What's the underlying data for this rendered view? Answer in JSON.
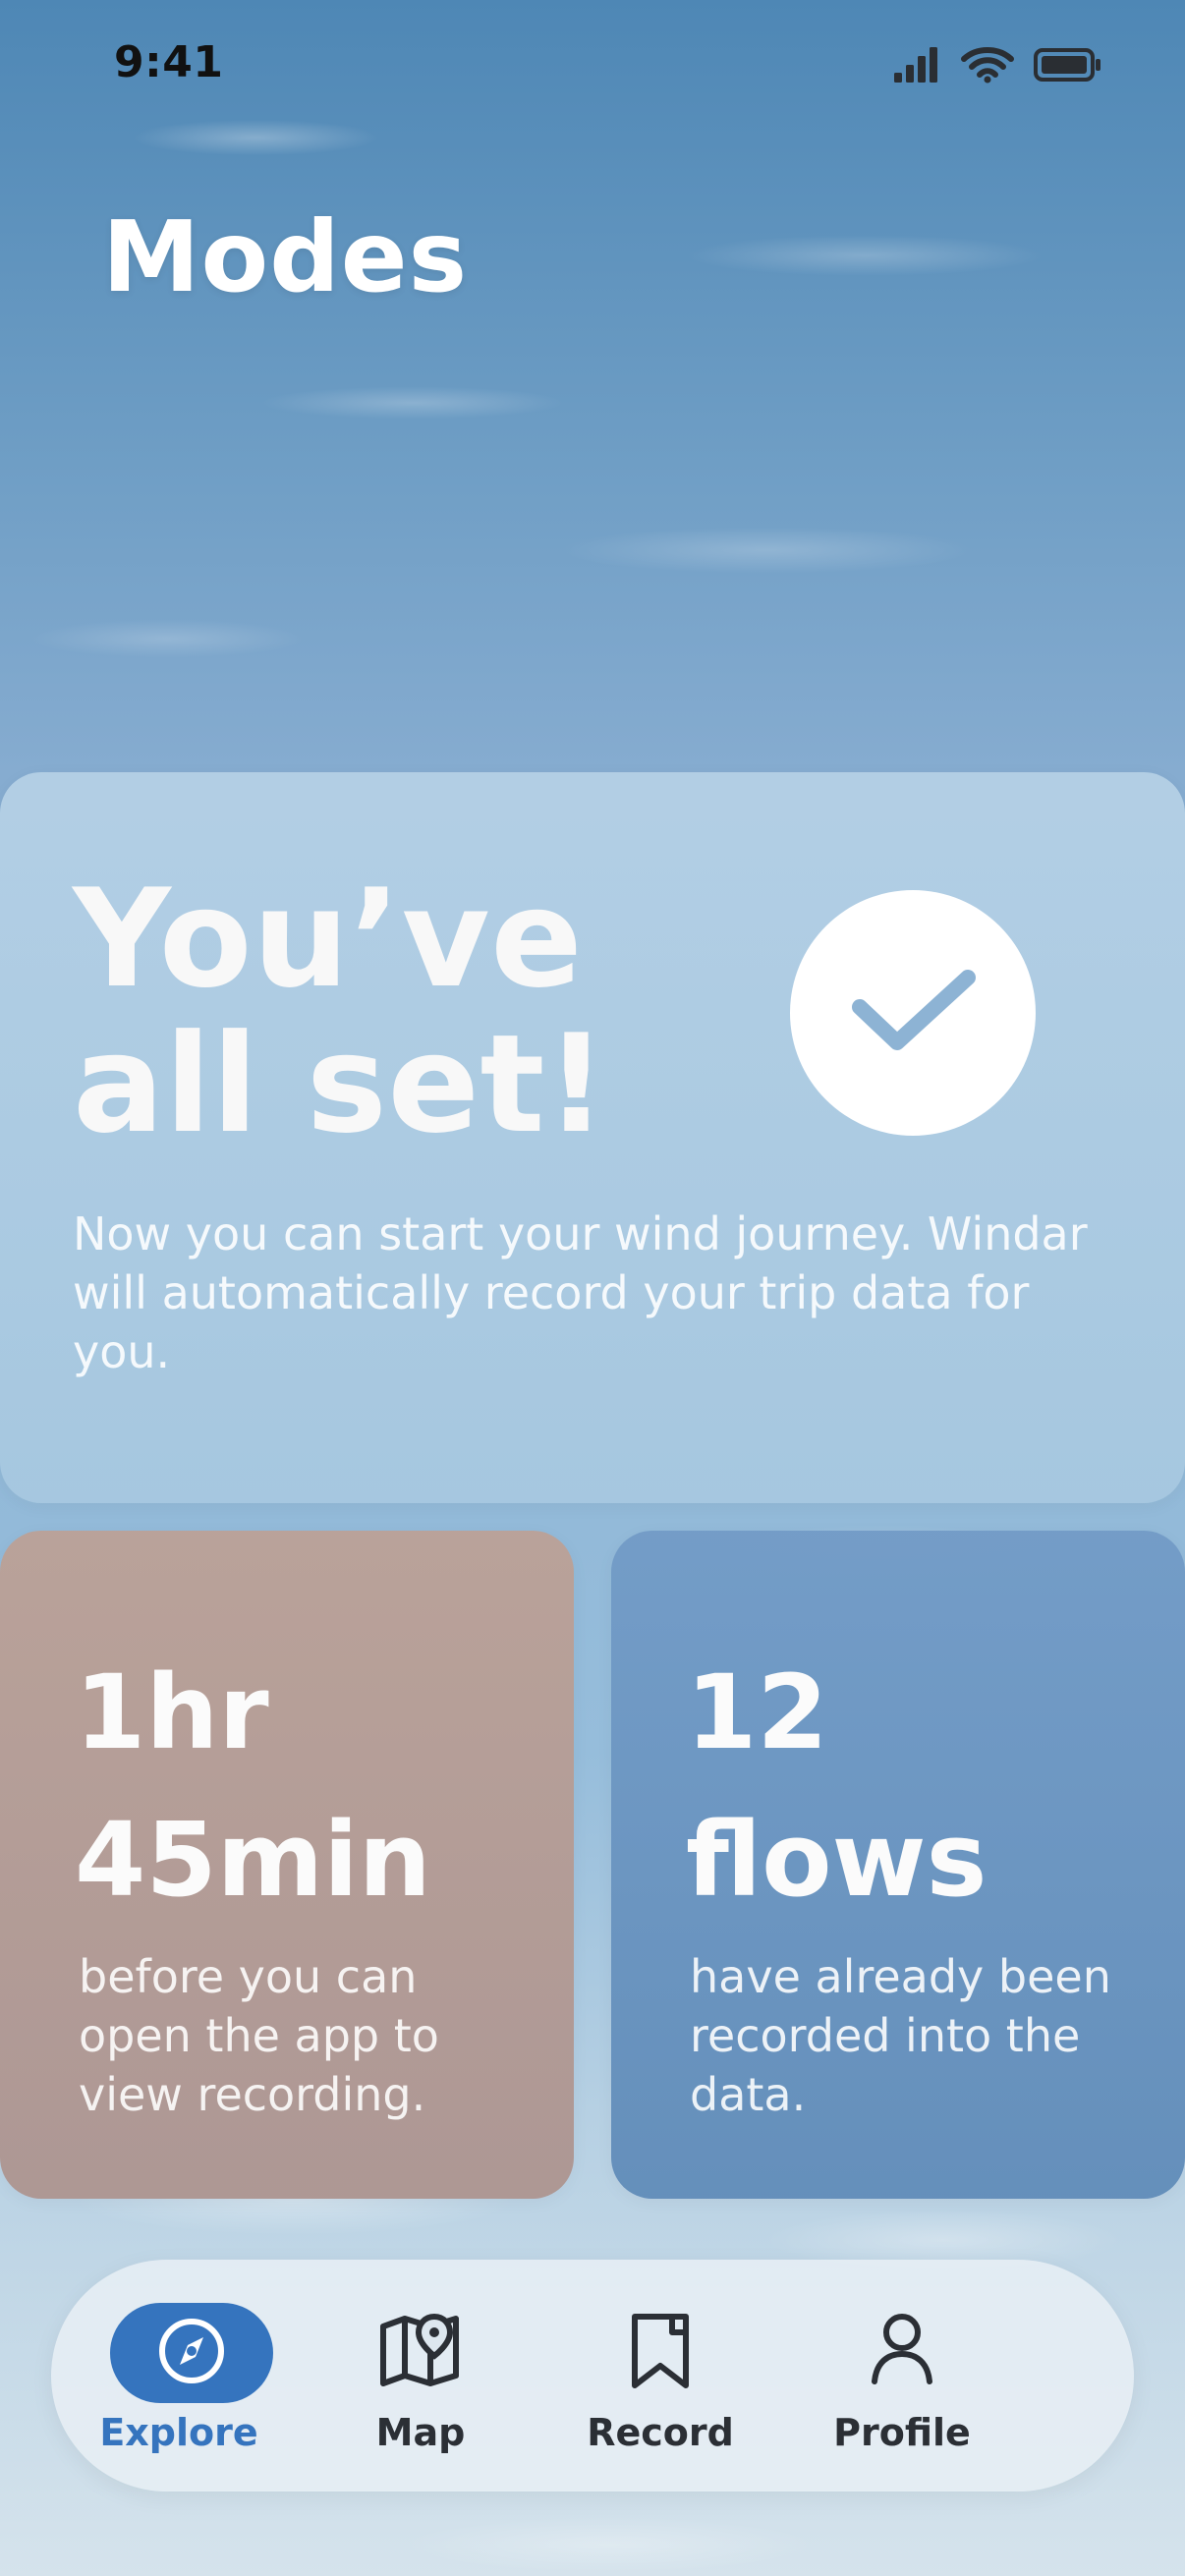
{
  "status_bar": {
    "time": "9:41",
    "icons": [
      "signal-bars-icon",
      "wifi-icon",
      "battery-icon"
    ]
  },
  "header": {
    "title": "Modes"
  },
  "main_card": {
    "title_line_1": "You’ve",
    "title_line_2": "all set!",
    "description": "Now you can start your wind journey. Windar will automatically record your trip data for you.",
    "icon": "check-icon",
    "colors": {
      "badge": "#ffffff",
      "check": "#8db3d4"
    }
  },
  "stats": [
    {
      "value_line_1": "1hr",
      "value_line_2": "45min",
      "description": "before you can open the app to view recording.",
      "color": "#b39b96"
    },
    {
      "value_line_1": "12",
      "value_line_2": "flows",
      "description": "have already been recorded into the data.",
      "color": "#6f96c3"
    }
  ],
  "bottom_nav": {
    "items": [
      {
        "label": "Explore",
        "icon": "compass-icon",
        "active": true
      },
      {
        "label": "Map",
        "icon": "map-pin-icon",
        "active": false
      },
      {
        "label": "Record",
        "icon": "bookmark-icon",
        "active": false
      },
      {
        "label": "Profile",
        "icon": "user-icon",
        "active": false
      }
    ],
    "colors": {
      "active": "#3574be",
      "inactive": "#2b2f35"
    }
  }
}
